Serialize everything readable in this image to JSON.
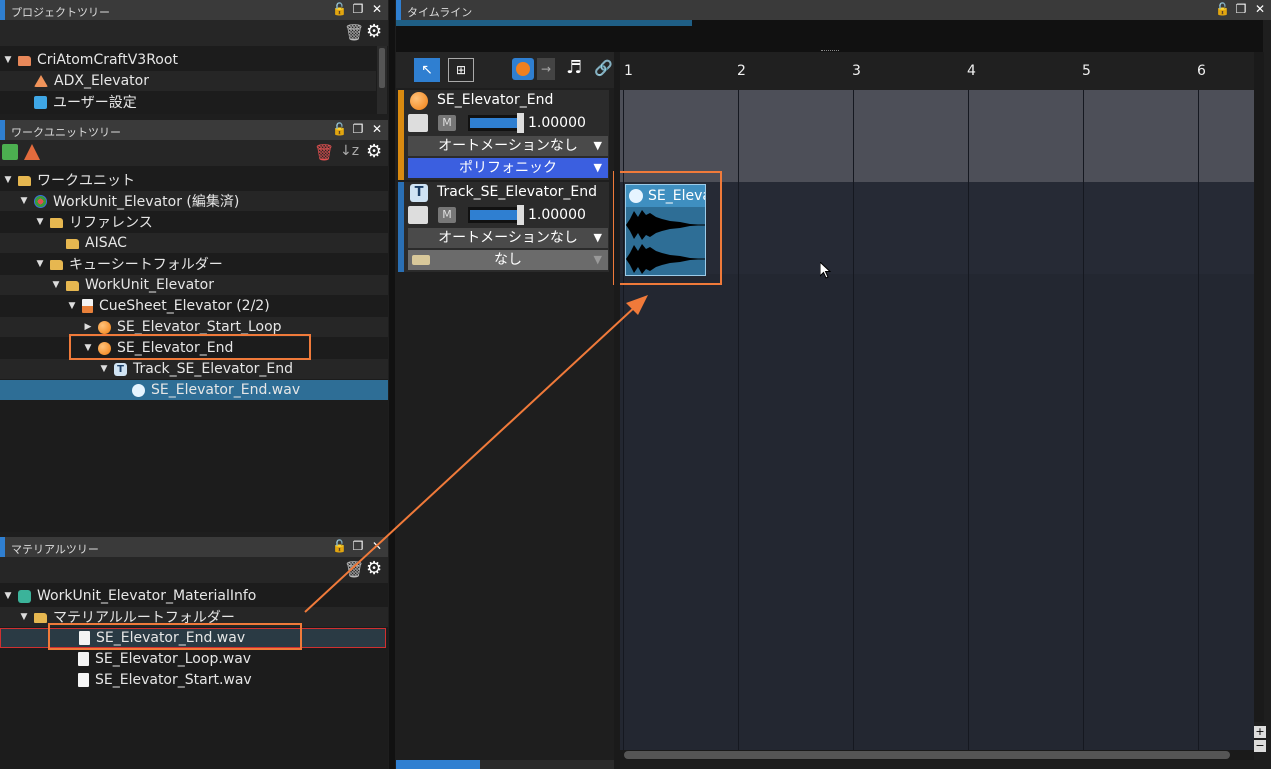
{
  "project_tree": {
    "title": "プロジェクトツリー",
    "items": [
      {
        "label": "CriAtomCraftV3Root"
      },
      {
        "label": "ADX_Elevator"
      },
      {
        "label": "ユーザー設定"
      }
    ]
  },
  "workunit_tree": {
    "title": "ワークユニットツリー",
    "items": [
      {
        "label": "ワークユニット"
      },
      {
        "label": "WorkUnit_Elevator (編集済)"
      },
      {
        "label": "リファレンス"
      },
      {
        "label": "AISAC"
      },
      {
        "label": "キューシートフォルダー"
      },
      {
        "label": "WorkUnit_Elevator"
      },
      {
        "label": "CueSheet_Elevator (2/2)"
      },
      {
        "label": "SE_Elevator_Start_Loop"
      },
      {
        "label": "SE_Elevator_End"
      },
      {
        "label": "Track_SE_Elevator_End"
      },
      {
        "label": "SE_Elevator_End.wav"
      }
    ]
  },
  "material_tree": {
    "title": "マテリアルツリー",
    "items": [
      {
        "label": "WorkUnit_Elevator_MaterialInfo"
      },
      {
        "label": "マテリアルルートフォルダー"
      },
      {
        "label": "SE_Elevator_End.wav"
      },
      {
        "label": "SE_Elevator_Loop.wav"
      },
      {
        "label": "SE_Elevator_Start.wav"
      }
    ]
  },
  "timeline": {
    "title": "タイムライン",
    "ruler": [
      "1",
      "2",
      "3",
      "4",
      "5",
      "6"
    ],
    "cue": {
      "name": "SE_Elevator_End",
      "m_label": "M",
      "volume": "1.00000",
      "automation": "オートメーションなし",
      "mode": "ポリフォニック"
    },
    "track": {
      "name": "Track_SE_Elevator_End",
      "m_label": "M",
      "volume": "1.00000",
      "automation": "オートメーションなし",
      "mode": "なし"
    },
    "clip_label": "SE_Eleva"
  },
  "colors": {
    "accent": "#2f7fd1",
    "highlight": "#f07a3a",
    "cue_stripe": "#d98a10",
    "track_stripe": "#2a6fb4",
    "selected_row": "#2e6e96",
    "polyphonic_button": "#3b5fe0"
  },
  "icons": [
    "lock-icon",
    "restore-icon",
    "close-icon",
    "trash-icon",
    "gear-icon",
    "sort-icon",
    "pointer-tool-icon",
    "marquee-tool-icon",
    "note-icon",
    "link-icon"
  ]
}
